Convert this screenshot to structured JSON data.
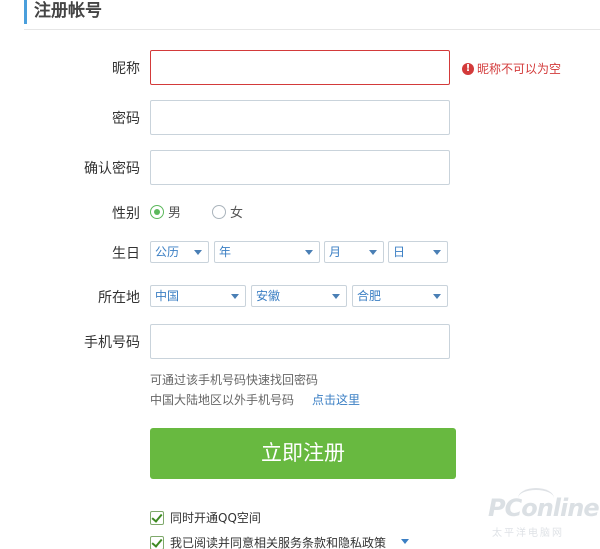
{
  "page": {
    "title": "注册帐号"
  },
  "nickname": {
    "label": "昵称",
    "value": "",
    "error": "昵称不可以为空",
    "error_icon": "!"
  },
  "password": {
    "label": "密码",
    "value": ""
  },
  "confirm_password": {
    "label": "确认密码",
    "value": ""
  },
  "gender": {
    "label": "性别",
    "options": [
      "男",
      "女"
    ],
    "selected": "男"
  },
  "birthday": {
    "label": "生日",
    "calendar": "公历",
    "year": "年",
    "month": "月",
    "day": "日"
  },
  "location": {
    "label": "所在地",
    "country": "中国",
    "province": "安徽",
    "city": "合肥"
  },
  "phone": {
    "label": "手机号码",
    "value": "",
    "hint": "可通过该手机号码快速找回密码",
    "foreign_hint": "中国大陆地区以外手机号码",
    "foreign_link": "点击这里"
  },
  "submit_label": "立即注册",
  "options": {
    "qzone": {
      "label": "同时开通QQ空间",
      "checked": true
    },
    "agreement": {
      "label": "我已阅读并同意相关服务条款和隐私政策",
      "checked": true
    }
  },
  "watermark": {
    "brand": "PConline",
    "sub": "太平洋电脑网"
  },
  "colors": {
    "accent": "#4a9fdc",
    "error": "#d33a3a",
    "button": "#68b940",
    "link": "#3b7fc4"
  }
}
